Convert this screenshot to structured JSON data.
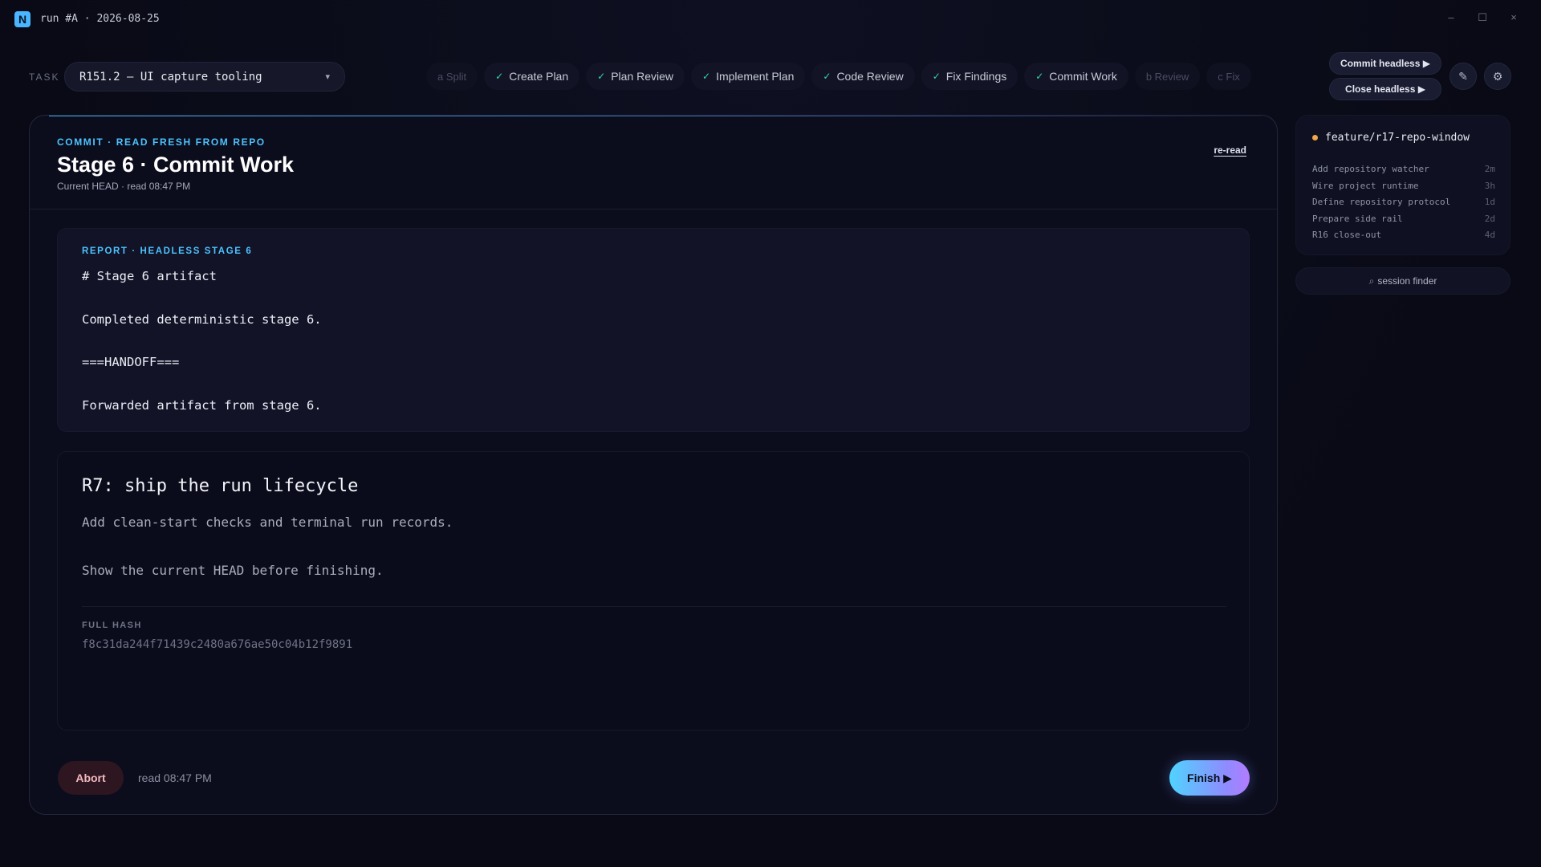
{
  "window": {
    "logo_letter": "N",
    "title": "run #A · 2026-08-25",
    "minimize": "–",
    "maximize": "☐",
    "close": "×"
  },
  "toolbar": {
    "task_label": "TASK",
    "task_value": "R151.2 — UI capture tooling",
    "task_chevron": "▾",
    "stages": [
      {
        "label": "a Split",
        "done": false
      },
      {
        "label": "Create Plan",
        "done": true
      },
      {
        "label": "Plan Review",
        "done": true
      },
      {
        "label": "Implement Plan",
        "done": true
      },
      {
        "label": "Code Review",
        "done": true
      },
      {
        "label": "Fix Findings",
        "done": true
      },
      {
        "label": "Commit Work",
        "done": true
      },
      {
        "label": "b Review",
        "done": false
      },
      {
        "label": "c Fix",
        "done": false
      }
    ],
    "check_glyph": "✓",
    "commit_headless": "Commit headless ▶",
    "close_headless": "Close headless ▶",
    "edit_icon": "✎",
    "settings_icon": "⚙"
  },
  "main": {
    "eyebrow": "COMMIT · READ FRESH FROM REPO",
    "title": "Stage 6 · Commit Work",
    "subtitle": "Current HEAD · read 08:47 PM",
    "reread": "re-read",
    "report": {
      "eyebrow": "REPORT · HEADLESS STAGE 6",
      "lines": [
        "# Stage 6 artifact",
        "Completed deterministic stage 6.",
        "===HANDOFF===",
        "Forwarded artifact from stage 6."
      ]
    },
    "commit": {
      "title": "R7: ship the run lifecycle",
      "body": [
        "Add clean-start checks and terminal run records.",
        "Show the current HEAD before finishing."
      ],
      "hash_label": "FULL HASH",
      "hash": "f8c31da244f71439c2480a676ae50c04b12f9891"
    },
    "abort": "Abort",
    "read_time": "read 08:47 PM",
    "finish": "Finish ▶"
  },
  "side": {
    "branch": "feature/r17-repo-window",
    "branch_color": "#f2a84a",
    "commits": [
      {
        "message": "Add repository watcher",
        "age": "2m"
      },
      {
        "message": "Wire project runtime",
        "age": "3h"
      },
      {
        "message": "Define repository protocol",
        "age": "1d"
      },
      {
        "message": "Prepare side rail",
        "age": "2d"
      },
      {
        "message": "R16 close-out",
        "age": "4d"
      }
    ],
    "session_finder_icon": "⌕",
    "session_finder": "session finder"
  }
}
